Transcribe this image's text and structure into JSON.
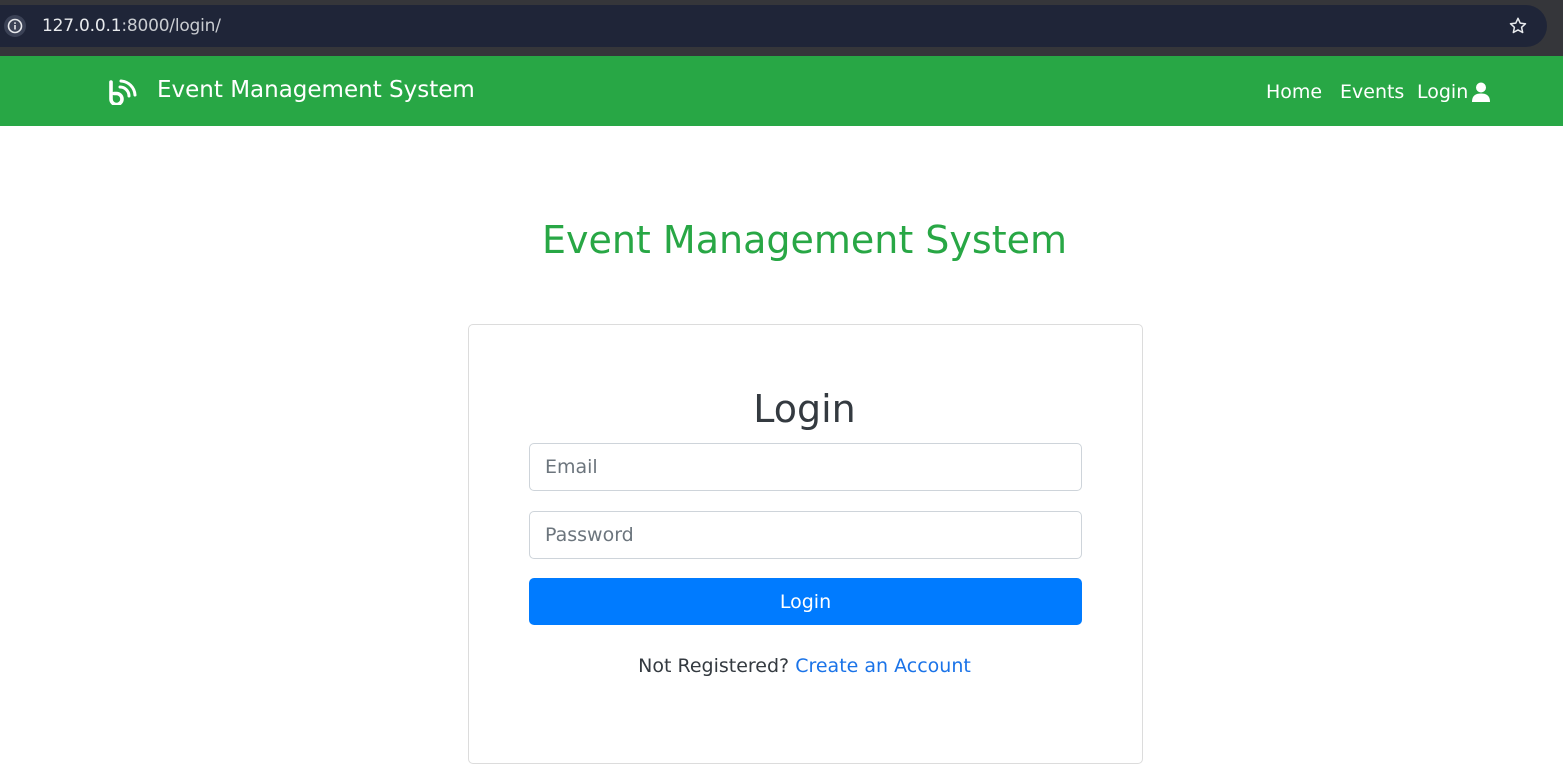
{
  "browser": {
    "url_host": "127.0.0.1",
    "url_rest": ":8000/login/"
  },
  "navbar": {
    "brand": "Event Management System",
    "links": [
      {
        "label": "Home"
      },
      {
        "label": "Events"
      },
      {
        "label": "Login"
      }
    ],
    "bg_color": "#28a745"
  },
  "page": {
    "heading": "Event Management System"
  },
  "login_form": {
    "title": "Login",
    "email_placeholder": "Email",
    "password_placeholder": "Password",
    "submit_label": "Login",
    "register_prompt": "Not Registered?",
    "register_link": "Create an Account"
  },
  "icons": {
    "browser_info": "info-icon",
    "bookmark": "star-icon",
    "brand": "brand-logo-icon",
    "user": "user-icon"
  },
  "colors": {
    "primary_button": "#007bff",
    "heading_green": "#28a745",
    "link_blue": "#1a73e8"
  }
}
